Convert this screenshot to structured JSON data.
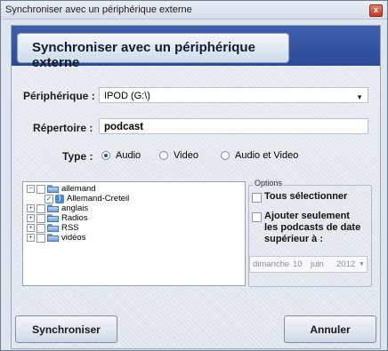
{
  "window": {
    "title": "Synchroniser avec un périphérique externe",
    "close_glyph": "x"
  },
  "header": {
    "title": "Synchroniser avec un périphérique externe"
  },
  "form": {
    "device_label": "Périphérique :",
    "device_value": "IPOD (G:\\)",
    "dropdown_arrow": "▼",
    "directory_label": "Répertoire :",
    "directory_value": "podcast",
    "type_label": "Type :",
    "type_options": [
      "Audio",
      "Video",
      "Audio et Video"
    ],
    "type_selected": "Audio"
  },
  "tree": {
    "items": [
      {
        "label": "allemand",
        "expander": "−",
        "checked": ""
      },
      {
        "label": "Allemand-Creteil",
        "expander": "",
        "checked": "✓"
      },
      {
        "label": "anglais",
        "expander": "+",
        "checked": ""
      },
      {
        "label": "Radios",
        "expander": "+",
        "checked": ""
      },
      {
        "label": "RSS",
        "expander": "+",
        "checked": ""
      },
      {
        "label": "vidéos",
        "expander": "+",
        "checked": ""
      }
    ]
  },
  "options": {
    "legend": "Options",
    "select_all": "Tous sélectionner",
    "only_recent_line1": "Ajouter seulement",
    "only_recent_line2": "les podcasts de date",
    "only_recent_line3": "supérieur à :",
    "date_day_name": "dimanche",
    "date_day": "10",
    "date_month": "juin",
    "date_year": "2012",
    "date_arrow": "▼"
  },
  "buttons": {
    "sync": "Synchroniser",
    "cancel": "Annuler"
  },
  "colors": {
    "header": "#2c4a95",
    "accent": "#1d4fa1",
    "close": "#c13b22"
  }
}
